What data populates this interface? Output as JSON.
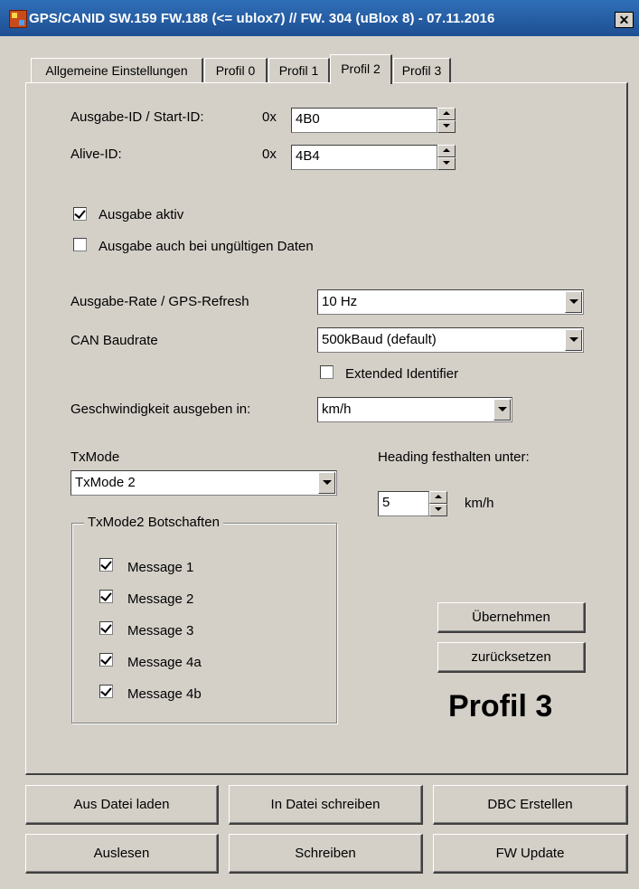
{
  "window": {
    "title": "GPS/CANID SW.159 FW.188 (<= ublox7) // FW. 304 (uBlox 8) - 07.11.2016",
    "close_glyph": "✕"
  },
  "tabs": [
    {
      "label": "Allgemeine Einstellungen",
      "active": false
    },
    {
      "label": "Profil 0",
      "active": false
    },
    {
      "label": "Profil 1",
      "active": false
    },
    {
      "label": "Profil 2",
      "active": true
    },
    {
      "label": "Profil 3",
      "active": false
    }
  ],
  "ids": {
    "output_label": "Ausgabe-ID / Start-ID:",
    "output_prefix": "0x",
    "output_value": "4B0",
    "alive_label": "Alive-ID:",
    "alive_prefix": "0x",
    "alive_value": "4B4"
  },
  "output": {
    "active_label": "Ausgabe aktiv",
    "active_checked": true,
    "invalid_label": "Ausgabe auch bei ungültigen Daten",
    "invalid_checked": false
  },
  "settings": {
    "rate_label": "Ausgabe-Rate / GPS-Refresh",
    "rate_value": "10 Hz",
    "baud_label": "CAN Baudrate",
    "baud_value": "500kBaud (default)",
    "extended_label": "Extended Identifier",
    "extended_checked": false,
    "speed_label": "Geschwindigkeit ausgeben in:",
    "speed_value": "km/h"
  },
  "txmode": {
    "label": "TxMode",
    "value": "TxMode 2",
    "group_title": "TxMode2  Botschaften",
    "messages": [
      {
        "label": "Message 1",
        "checked": true
      },
      {
        "label": "Message 2",
        "checked": true
      },
      {
        "label": "Message 3",
        "checked": true
      },
      {
        "label": "Message 4a",
        "checked": true
      },
      {
        "label": "Message 4b",
        "checked": true
      }
    ]
  },
  "heading": {
    "label": "Heading festhalten unter:",
    "value": "5",
    "unit": "km/h"
  },
  "actions": {
    "apply_label": "Übernehmen",
    "reset_label": "zurücksetzen",
    "profile_display": "Profil 3"
  },
  "bottom_buttons": {
    "load_file": "Aus Datei laden",
    "write_file": "In Datei schreiben",
    "dbc_create": "DBC Erstellen",
    "read": "Auslesen",
    "write": "Schreiben",
    "fw_update": "FW Update"
  }
}
